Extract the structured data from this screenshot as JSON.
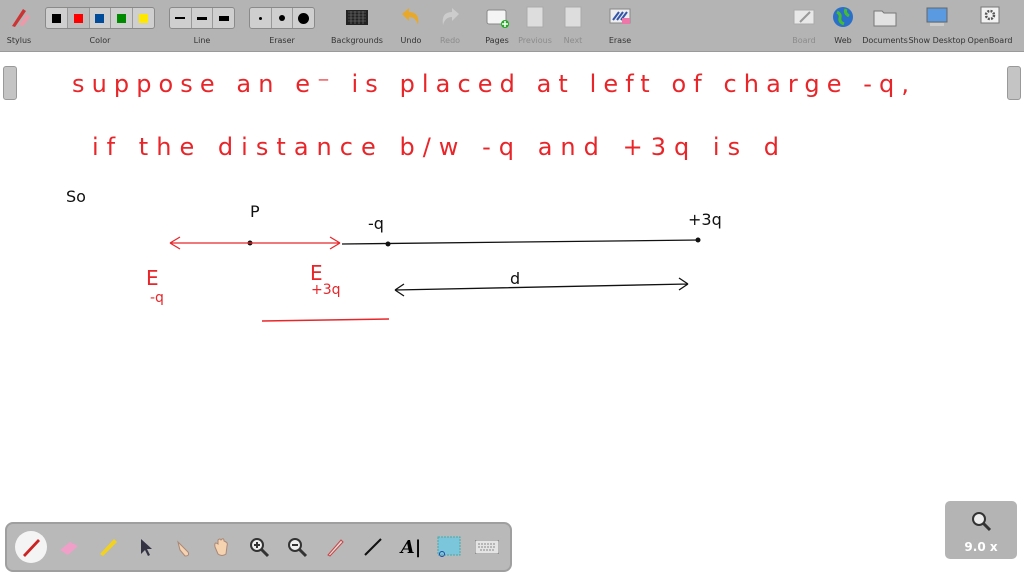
{
  "toolbar": {
    "stylus": "Stylus",
    "color": "Color",
    "line": "Line",
    "eraser": "Eraser",
    "backgrounds": "Backgrounds",
    "undo": "Undo",
    "redo": "Redo",
    "pages": "Pages",
    "previous": "Previous",
    "next": "Next",
    "erase": "Erase",
    "board": "Board",
    "web": "Web",
    "documents": "Documents",
    "show_desktop": "Show Desktop",
    "openboard": "OpenBoard",
    "colors": [
      "#000000",
      "#ff0000",
      "#004b9a",
      "#008a00",
      "#ffe800"
    ]
  },
  "board": {
    "line1": "suppose an e⁻ is placed at left of charge -q,",
    "line2": "if the distance b/w -q and +3q is d",
    "so": "So",
    "label_p": "P",
    "label_minus_q": "-q",
    "label_plus_3q": "+3q",
    "label_e": "E",
    "label_e_sub1": "-q",
    "label_e2": "E",
    "label_e_sub2": "+3q",
    "label_d": "d",
    "ink_red": "#e8262a"
  },
  "zoom": {
    "level": "9.0 x"
  }
}
